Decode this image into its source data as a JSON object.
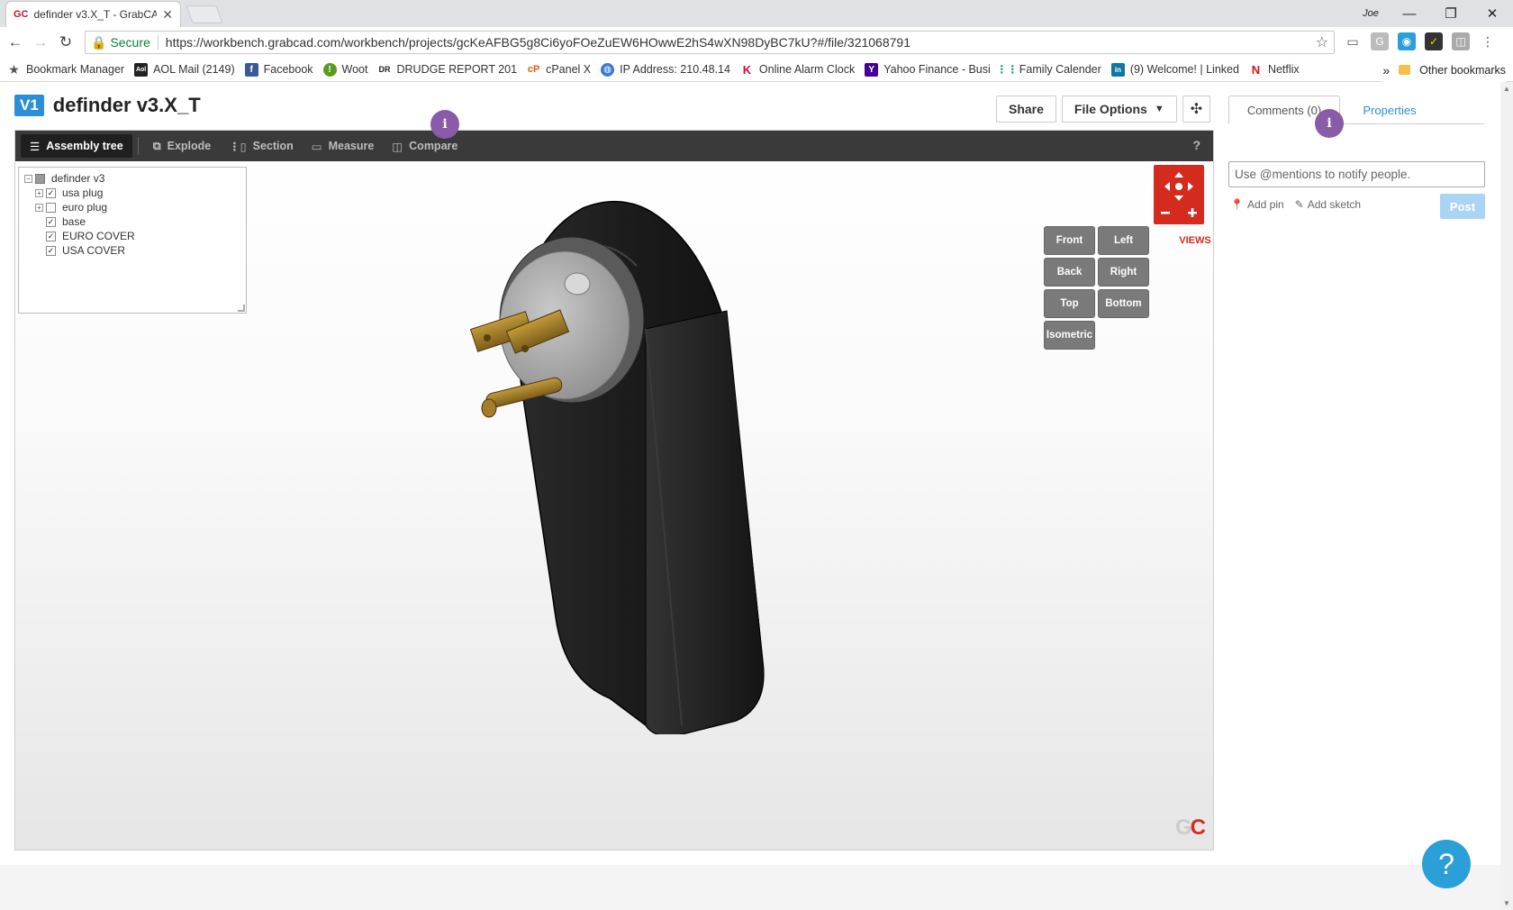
{
  "browser": {
    "tab_title": "definder v3.X_T - GrabCA",
    "tab_favicon": "GC",
    "user_label": "Joe",
    "secure_label": "Secure",
    "url": "https://workbench.grabcad.com/workbench/projects/gcKeAFBG5g8Ci6yoFOeZuEW6HOwwE2hS4wXN98DyBC7kU?#/file/321068791",
    "bookmarks": [
      {
        "label": "Bookmark Manager",
        "icon": "star-icon"
      },
      {
        "label": "AOL Mail (2149)",
        "icon": "aol-icon"
      },
      {
        "label": "Facebook",
        "icon": "facebook-icon"
      },
      {
        "label": "Woot",
        "icon": "woot-icon"
      },
      {
        "label": "DRUDGE REPORT 201",
        "icon": "drudge-icon"
      },
      {
        "label": "cPanel X",
        "icon": "cpanel-icon"
      },
      {
        "label": "IP Address: 210.48.14",
        "icon": "globe-icon"
      },
      {
        "label": "Online Alarm Clock",
        "icon": "k-icon"
      },
      {
        "label": "Yahoo Finance - Busi",
        "icon": "yahoo-icon"
      },
      {
        "label": "Family Calender",
        "icon": "calendar-icon"
      },
      {
        "label": "(9) Welcome! | Linked",
        "icon": "linkedin-icon"
      },
      {
        "label": "Netflix",
        "icon": "netflix-icon"
      }
    ],
    "more_bookmarks": "»",
    "other_bookmarks": "Other bookmarks"
  },
  "app": {
    "version_badge": "V1",
    "title": "definder v3.X_T",
    "share_label": "Share",
    "file_options_label": "File Options",
    "toolbar": {
      "assembly_tree": "Assembly tree",
      "explode": "Explode",
      "section": "Section",
      "measure": "Measure",
      "compare": "Compare",
      "help": "?"
    },
    "tree": [
      {
        "label": "definder v3",
        "expander": "⊟",
        "check": "partial",
        "indent": 0
      },
      {
        "label": "usa plug",
        "expander": "⊞",
        "check": "checked",
        "indent": 1
      },
      {
        "label": "euro plug",
        "expander": "⊞",
        "check": "empty",
        "indent": 1
      },
      {
        "label": "base",
        "expander": "",
        "check": "checked",
        "indent": 1
      },
      {
        "label": "EURO COVER",
        "expander": "",
        "check": "checked",
        "indent": 1
      },
      {
        "label": "USA COVER",
        "expander": "",
        "check": "checked",
        "indent": 1
      }
    ],
    "views_label": "VIEWS",
    "views": [
      "Front",
      "Left",
      "Back",
      "Right",
      "Top",
      "Bottom",
      "Isometric"
    ],
    "info_bubble": "i",
    "logo": {
      "g": "G",
      "c": "C"
    }
  },
  "panel": {
    "comments_tab": "Comments (0)",
    "properties_tab": "Properties",
    "comment_placeholder": "Use @mentions to notify people.",
    "add_pin": "Add pin",
    "add_sketch": "Add sketch",
    "post_label": "Post"
  },
  "help_fab": "?",
  "colors": {
    "accent": "#2d8ed8",
    "brand_red": "#d52b1e",
    "bubble": "#8a5ba8"
  }
}
